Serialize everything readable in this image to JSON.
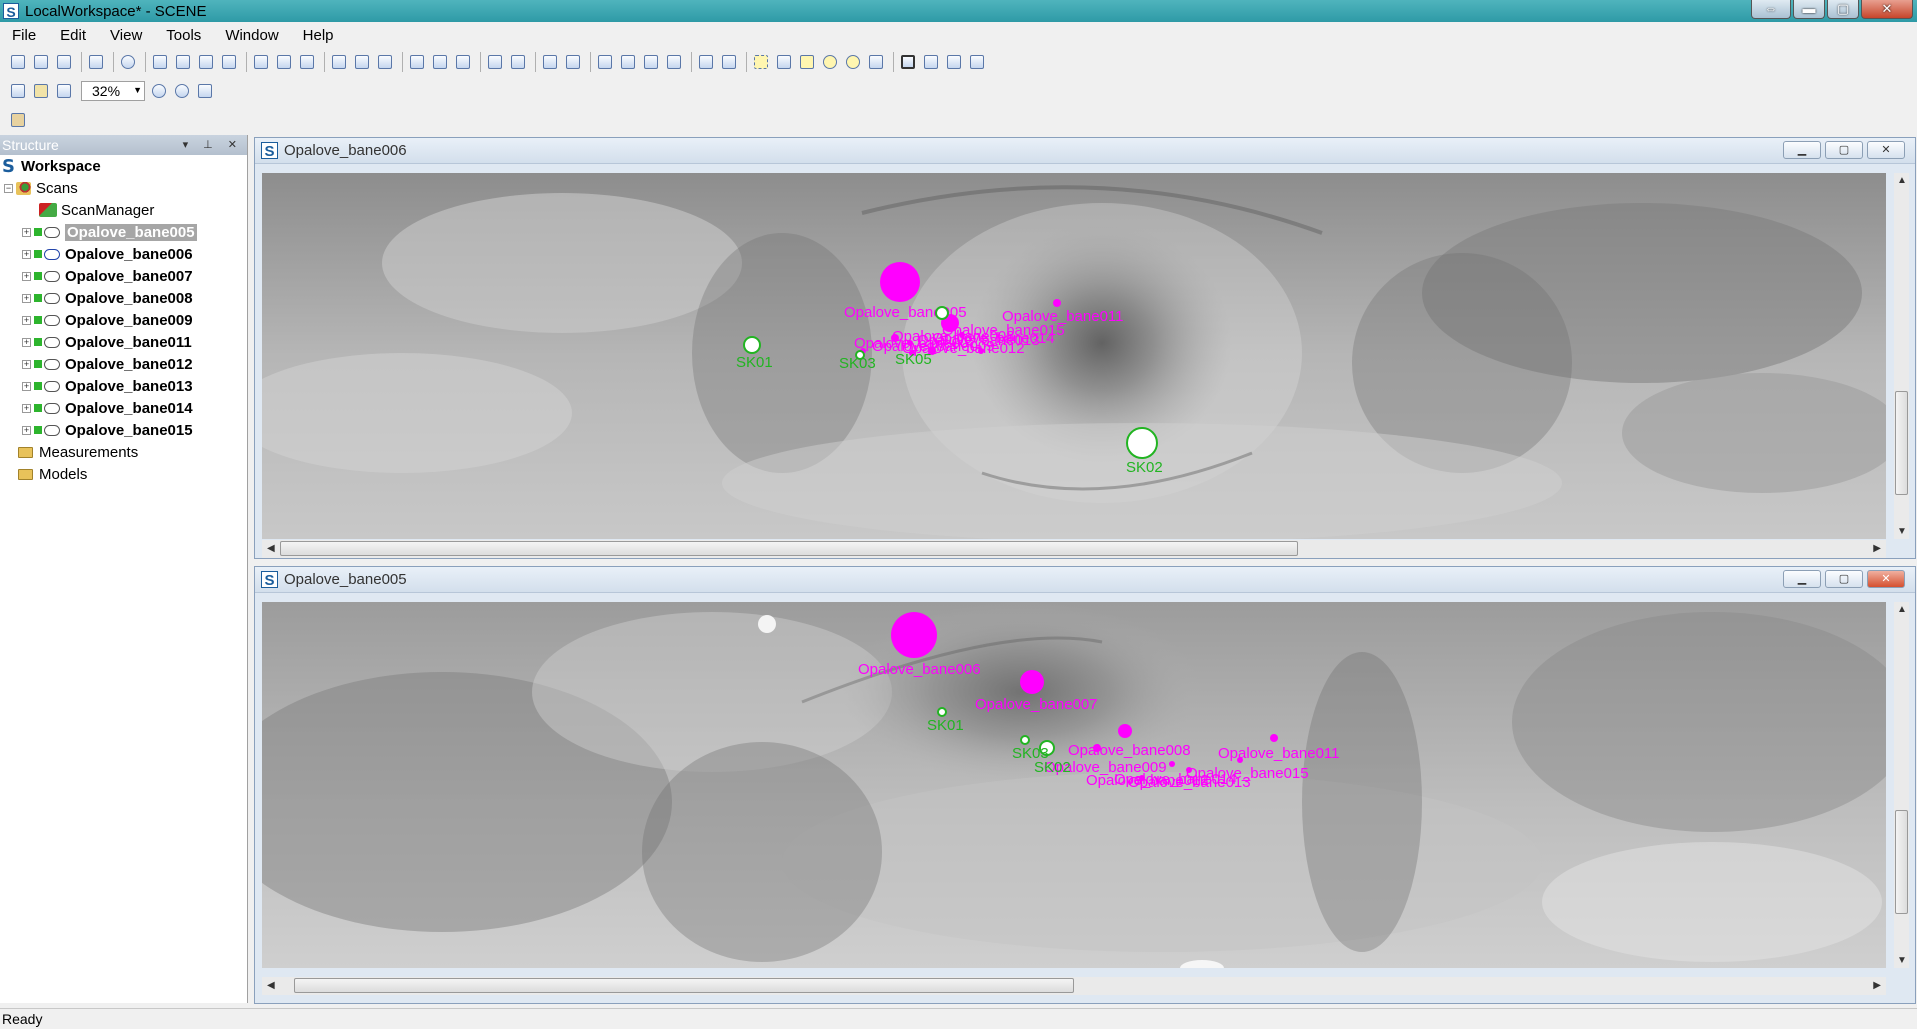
{
  "window": {
    "title": "LocalWorkspace* - SCENE"
  },
  "menu": [
    "File",
    "Edit",
    "View",
    "Tools",
    "Window",
    "Help"
  ],
  "toolbar": {
    "zoom_value": "32%"
  },
  "structure": {
    "header": "Structure",
    "workspace": "Workspace",
    "scans": "Scans",
    "scan_manager": "ScanManager",
    "scan_items": [
      "Opalove_bane005",
      "Opalove_bane006",
      "Opalove_bane007",
      "Opalove_bane008",
      "Opalove_bane009",
      "Opalove_bane011",
      "Opalove_bane012",
      "Opalove_bane013",
      "Opalove_bane014",
      "Opalove_bane015"
    ],
    "selected_scan": "Opalove_bane005",
    "measurements": "Measurements",
    "models": "Models"
  },
  "views": [
    {
      "title": "Opalove_bane006",
      "scan_labels": [
        "Opalove_bane005",
        "Opalove_bane007",
        "Opalove_bane008",
        "Opalove_bane009",
        "Opalove_bane011",
        "Opalove_bane012",
        "Opalove_bane013",
        "Opalove_bane014",
        "Opalove_bane015"
      ],
      "targets": [
        "SK01",
        "SK03",
        "SK05",
        "SK02"
      ]
    },
    {
      "title": "Opalove_bane005",
      "scan_labels": [
        "Opalove_bane006",
        "Opalove_bane007",
        "Opalove_bane008",
        "Opalove_bane009",
        "Opalove_bane011",
        "Opalove_bane012",
        "Opalove_bane013",
        "Opalove_bane014",
        "Opalove_bane015"
      ],
      "targets": [
        "SK01",
        "SK03",
        "SK02"
      ]
    }
  ],
  "colors": {
    "scan_marker": "#ff00ff",
    "target_marker": "#22b422",
    "titlebar": "#3aa6b0"
  },
  "status": {
    "text": "Ready"
  }
}
